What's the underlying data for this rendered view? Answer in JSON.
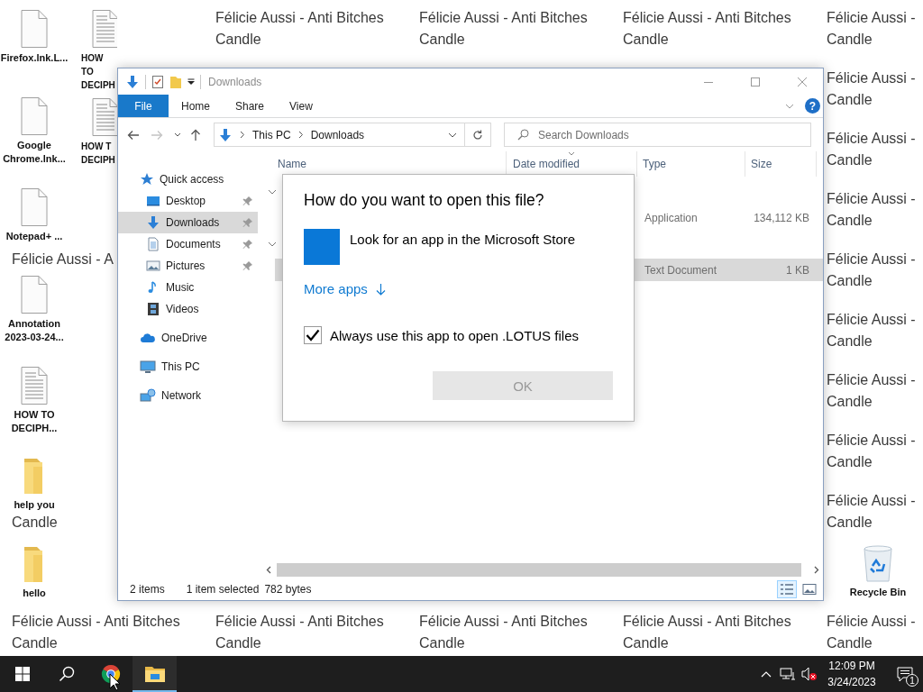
{
  "wallpaper": {
    "rows": [
      [
        {
          "kind": "covered"
        },
        {
          "kind": "tile",
          "lines": [
            "Félicie Aussi - Anti Bitches",
            "Candle"
          ]
        },
        {
          "kind": "tile",
          "lines": [
            "Félicie Aussi - Anti Bitches",
            "Candle"
          ]
        },
        {
          "kind": "tile",
          "lines": [
            "Félicie Aussi - Anti Bitches",
            "Candle"
          ]
        },
        {
          "kind": "tile",
          "lines": [
            "Félicie Aussi -",
            "Candle"
          ]
        }
      ],
      [
        {
          "kind": "covered"
        },
        {
          "kind": "covered"
        },
        {
          "kind": "covered"
        },
        {
          "kind": "covered"
        },
        {
          "kind": "tile",
          "lines": [
            "Félicie Aussi -",
            "Candle"
          ]
        }
      ],
      [
        {
          "kind": "covered"
        },
        {
          "kind": "covered"
        },
        {
          "kind": "covered"
        },
        {
          "kind": "covered"
        },
        {
          "kind": "tile",
          "lines": [
            "Félicie Aussi -",
            "Candle"
          ]
        }
      ],
      [
        {
          "kind": "covered"
        },
        {
          "kind": "covered"
        },
        {
          "kind": "covered"
        },
        {
          "kind": "covered"
        },
        {
          "kind": "tile",
          "lines": [
            "Félicie Aussi -",
            "Candle"
          ]
        }
      ],
      [
        {
          "kind": "top-line",
          "lines": [
            "Félicie Aussi - A"
          ]
        },
        {
          "kind": "covered"
        },
        {
          "kind": "covered"
        },
        {
          "kind": "covered"
        },
        {
          "kind": "tile",
          "lines": [
            "Félicie Aussi -",
            "Candle"
          ]
        }
      ],
      [
        {
          "kind": "covered"
        },
        {
          "kind": "covered"
        },
        {
          "kind": "covered"
        },
        {
          "kind": "covered"
        },
        {
          "kind": "tile",
          "lines": [
            "Félicie Aussi -",
            "Candle"
          ]
        }
      ],
      [
        {
          "kind": "covered"
        },
        {
          "kind": "covered"
        },
        {
          "kind": "covered"
        },
        {
          "kind": "covered"
        },
        {
          "kind": "tile",
          "lines": [
            "Félicie Aussi -",
            "Candle"
          ]
        }
      ],
      [
        {
          "kind": "covered"
        },
        {
          "kind": "covered"
        },
        {
          "kind": "covered"
        },
        {
          "kind": "covered"
        },
        {
          "kind": "tile",
          "lines": [
            "Félicie Aussi -",
            "Candle"
          ]
        }
      ],
      [
        {
          "kind": "bottom-line",
          "lines": [
            "Candle"
          ]
        },
        {
          "kind": "covered"
        },
        {
          "kind": "covered"
        },
        {
          "kind": "covered"
        },
        {
          "kind": "tile",
          "lines": [
            "Félicie Aussi -",
            "Candle"
          ]
        }
      ],
      [
        {
          "kind": "covered"
        },
        {
          "kind": "covered"
        },
        {
          "kind": "covered"
        },
        {
          "kind": "covered"
        },
        {
          "kind": "covered"
        }
      ],
      [
        {
          "kind": "tile",
          "lines": [
            "Félicie Aussi - Anti Bitches",
            "Candle"
          ]
        },
        {
          "kind": "tile",
          "lines": [
            "Félicie Aussi - Anti Bitches",
            "Candle"
          ]
        },
        {
          "kind": "tile",
          "lines": [
            "Félicie Aussi - Anti Bitches",
            "Candle"
          ]
        },
        {
          "kind": "tile",
          "lines": [
            "Félicie Aussi - Anti Bitches",
            "Candle"
          ]
        },
        {
          "kind": "tile",
          "lines": [
            "Félicie Aussi -",
            "Candle"
          ]
        }
      ]
    ]
  },
  "desktop_icons": [
    {
      "kind": "file",
      "label": "Firefox.lnk.L..."
    },
    {
      "kind": "text-file",
      "label": "HOW TO DECIPH"
    },
    {
      "kind": "file",
      "label": "Google Chrome.lnk..."
    },
    {
      "kind": "text-file",
      "label": "HOW T DECIPH"
    },
    {
      "kind": "file",
      "label": "Notepad+ ..."
    },
    {
      "kind": "file",
      "label": "Annotation 2023-03-24..."
    },
    {
      "kind": "text-file",
      "label": "HOW TO DECIPH..."
    },
    {
      "kind": "folder",
      "label": "help you"
    },
    {
      "kind": "folder",
      "label": "hello"
    },
    {
      "kind": "recycle-bin",
      "label": "Recycle Bin"
    }
  ],
  "explorer": {
    "title": "Downloads",
    "ribbon_tabs": [
      {
        "label": "File",
        "kind": "file-menu"
      },
      {
        "label": "Home",
        "kind": "tab"
      },
      {
        "label": "Share",
        "kind": "tab"
      },
      {
        "label": "View",
        "kind": "tab"
      }
    ],
    "help_button": {
      "label": "?"
    },
    "nav_buttons": [
      {
        "kind": "back",
        "disabled": false
      },
      {
        "kind": "forward",
        "disabled": true
      },
      {
        "kind": "recent",
        "disabled": false
      },
      {
        "kind": "up",
        "disabled": false
      }
    ],
    "breadcrumb": [
      "This PC",
      "Downloads"
    ],
    "search": {
      "placeholder": "Search Downloads"
    },
    "nav_pane": [
      {
        "label": "Quick access",
        "kind": "star",
        "selected": false,
        "children": [
          {
            "label": "Desktop",
            "kind": "desktop",
            "selected": false,
            "pinned": true
          },
          {
            "label": "Downloads",
            "kind": "downloads",
            "selected": true,
            "pinned": true
          },
          {
            "label": "Documents",
            "kind": "documents",
            "selected": false,
            "pinned": true
          },
          {
            "label": "Pictures",
            "kind": "pictures",
            "selected": false,
            "pinned": true
          },
          {
            "label": "Music",
            "kind": "music",
            "selected": false,
            "pinned": false
          },
          {
            "label": "Videos",
            "kind": "videos",
            "selected": false,
            "pinned": false
          }
        ]
      },
      {
        "label": "OneDrive",
        "kind": "cloud",
        "selected": false
      },
      {
        "label": "This PC",
        "kind": "computer",
        "selected": false
      },
      {
        "label": "Network",
        "kind": "network",
        "selected": false
      }
    ],
    "columns": [
      {
        "label": "Name",
        "sorted": false
      },
      {
        "label": "Date modified",
        "sorted": true
      },
      {
        "label": "Type",
        "sorted": false
      },
      {
        "label": "Size",
        "sorted": false
      }
    ],
    "groups": [
      {
        "expanded": true,
        "rows": [
          {
            "type": "Application",
            "size": "134,112 KB",
            "selected": false
          }
        ]
      },
      {
        "expanded": true,
        "rows": [
          {
            "type": "Text Document",
            "size": "1 KB",
            "selected": true
          }
        ]
      }
    ],
    "status_bar": {
      "item_count": "2 items",
      "selection": "1 item selected",
      "selection_size": "782 bytes"
    },
    "views": [
      {
        "kind": "details",
        "selected": true
      },
      {
        "kind": "large-icons",
        "selected": false
      }
    ]
  },
  "dialog": {
    "title": "How do you want to open this file?",
    "options": [
      {
        "label": "Look for an app in the Microsoft Store"
      }
    ],
    "more_apps": "More apps",
    "always_use": {
      "label": "Always use this app to open .LOTUS files",
      "checked": true
    },
    "ok_button": {
      "label": "OK",
      "disabled": true
    }
  },
  "taskbar": {
    "buttons": [
      {
        "kind": "start",
        "active": false
      },
      {
        "kind": "search",
        "active": false
      },
      {
        "kind": "browser",
        "active": false
      },
      {
        "kind": "file-explorer",
        "active": true
      }
    ],
    "tray": {
      "volume_muted": true
    },
    "clock": {
      "time": "12:09 PM",
      "date": "3/24/2023"
    },
    "notifications": {
      "count": "1"
    }
  }
}
